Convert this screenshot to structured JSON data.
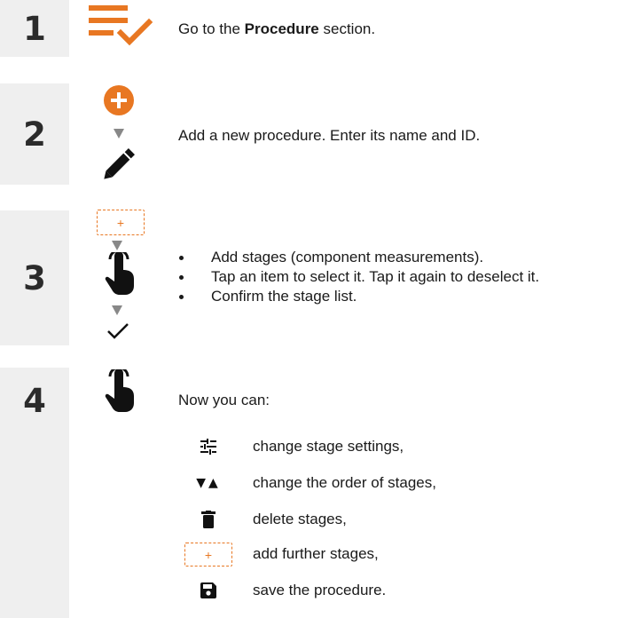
{
  "steps": [
    {
      "number": "1",
      "text_before": "Go to the ",
      "text_bold": "Procedure",
      "text_after": " section."
    },
    {
      "number": "2",
      "text": "Add a new procedure. Enter its name and ID."
    },
    {
      "number": "3",
      "bullets": [
        "Add stages (component measurements).",
        "Tap an item to select it. Tap it again to deselect it.",
        "Confirm the stage list."
      ]
    },
    {
      "number": "4",
      "text": "Now you can:",
      "items": [
        {
          "icon": "sliders-icon",
          "text": "change stage settings,"
        },
        {
          "icon": "reorder-arrows-icon",
          "text": "change the order of stages,"
        },
        {
          "icon": "trash-icon",
          "text": "delete stages,"
        },
        {
          "icon": "add-stage-box-icon",
          "text": "add further stages,"
        },
        {
          "icon": "save-icon",
          "text": "save the procedure."
        }
      ]
    }
  ],
  "glyphs": {
    "plus": "+",
    "reorder": "▼▲"
  },
  "colors": {
    "accent": "#e87722",
    "number_box": "#efefef",
    "arrow": "#888888"
  }
}
